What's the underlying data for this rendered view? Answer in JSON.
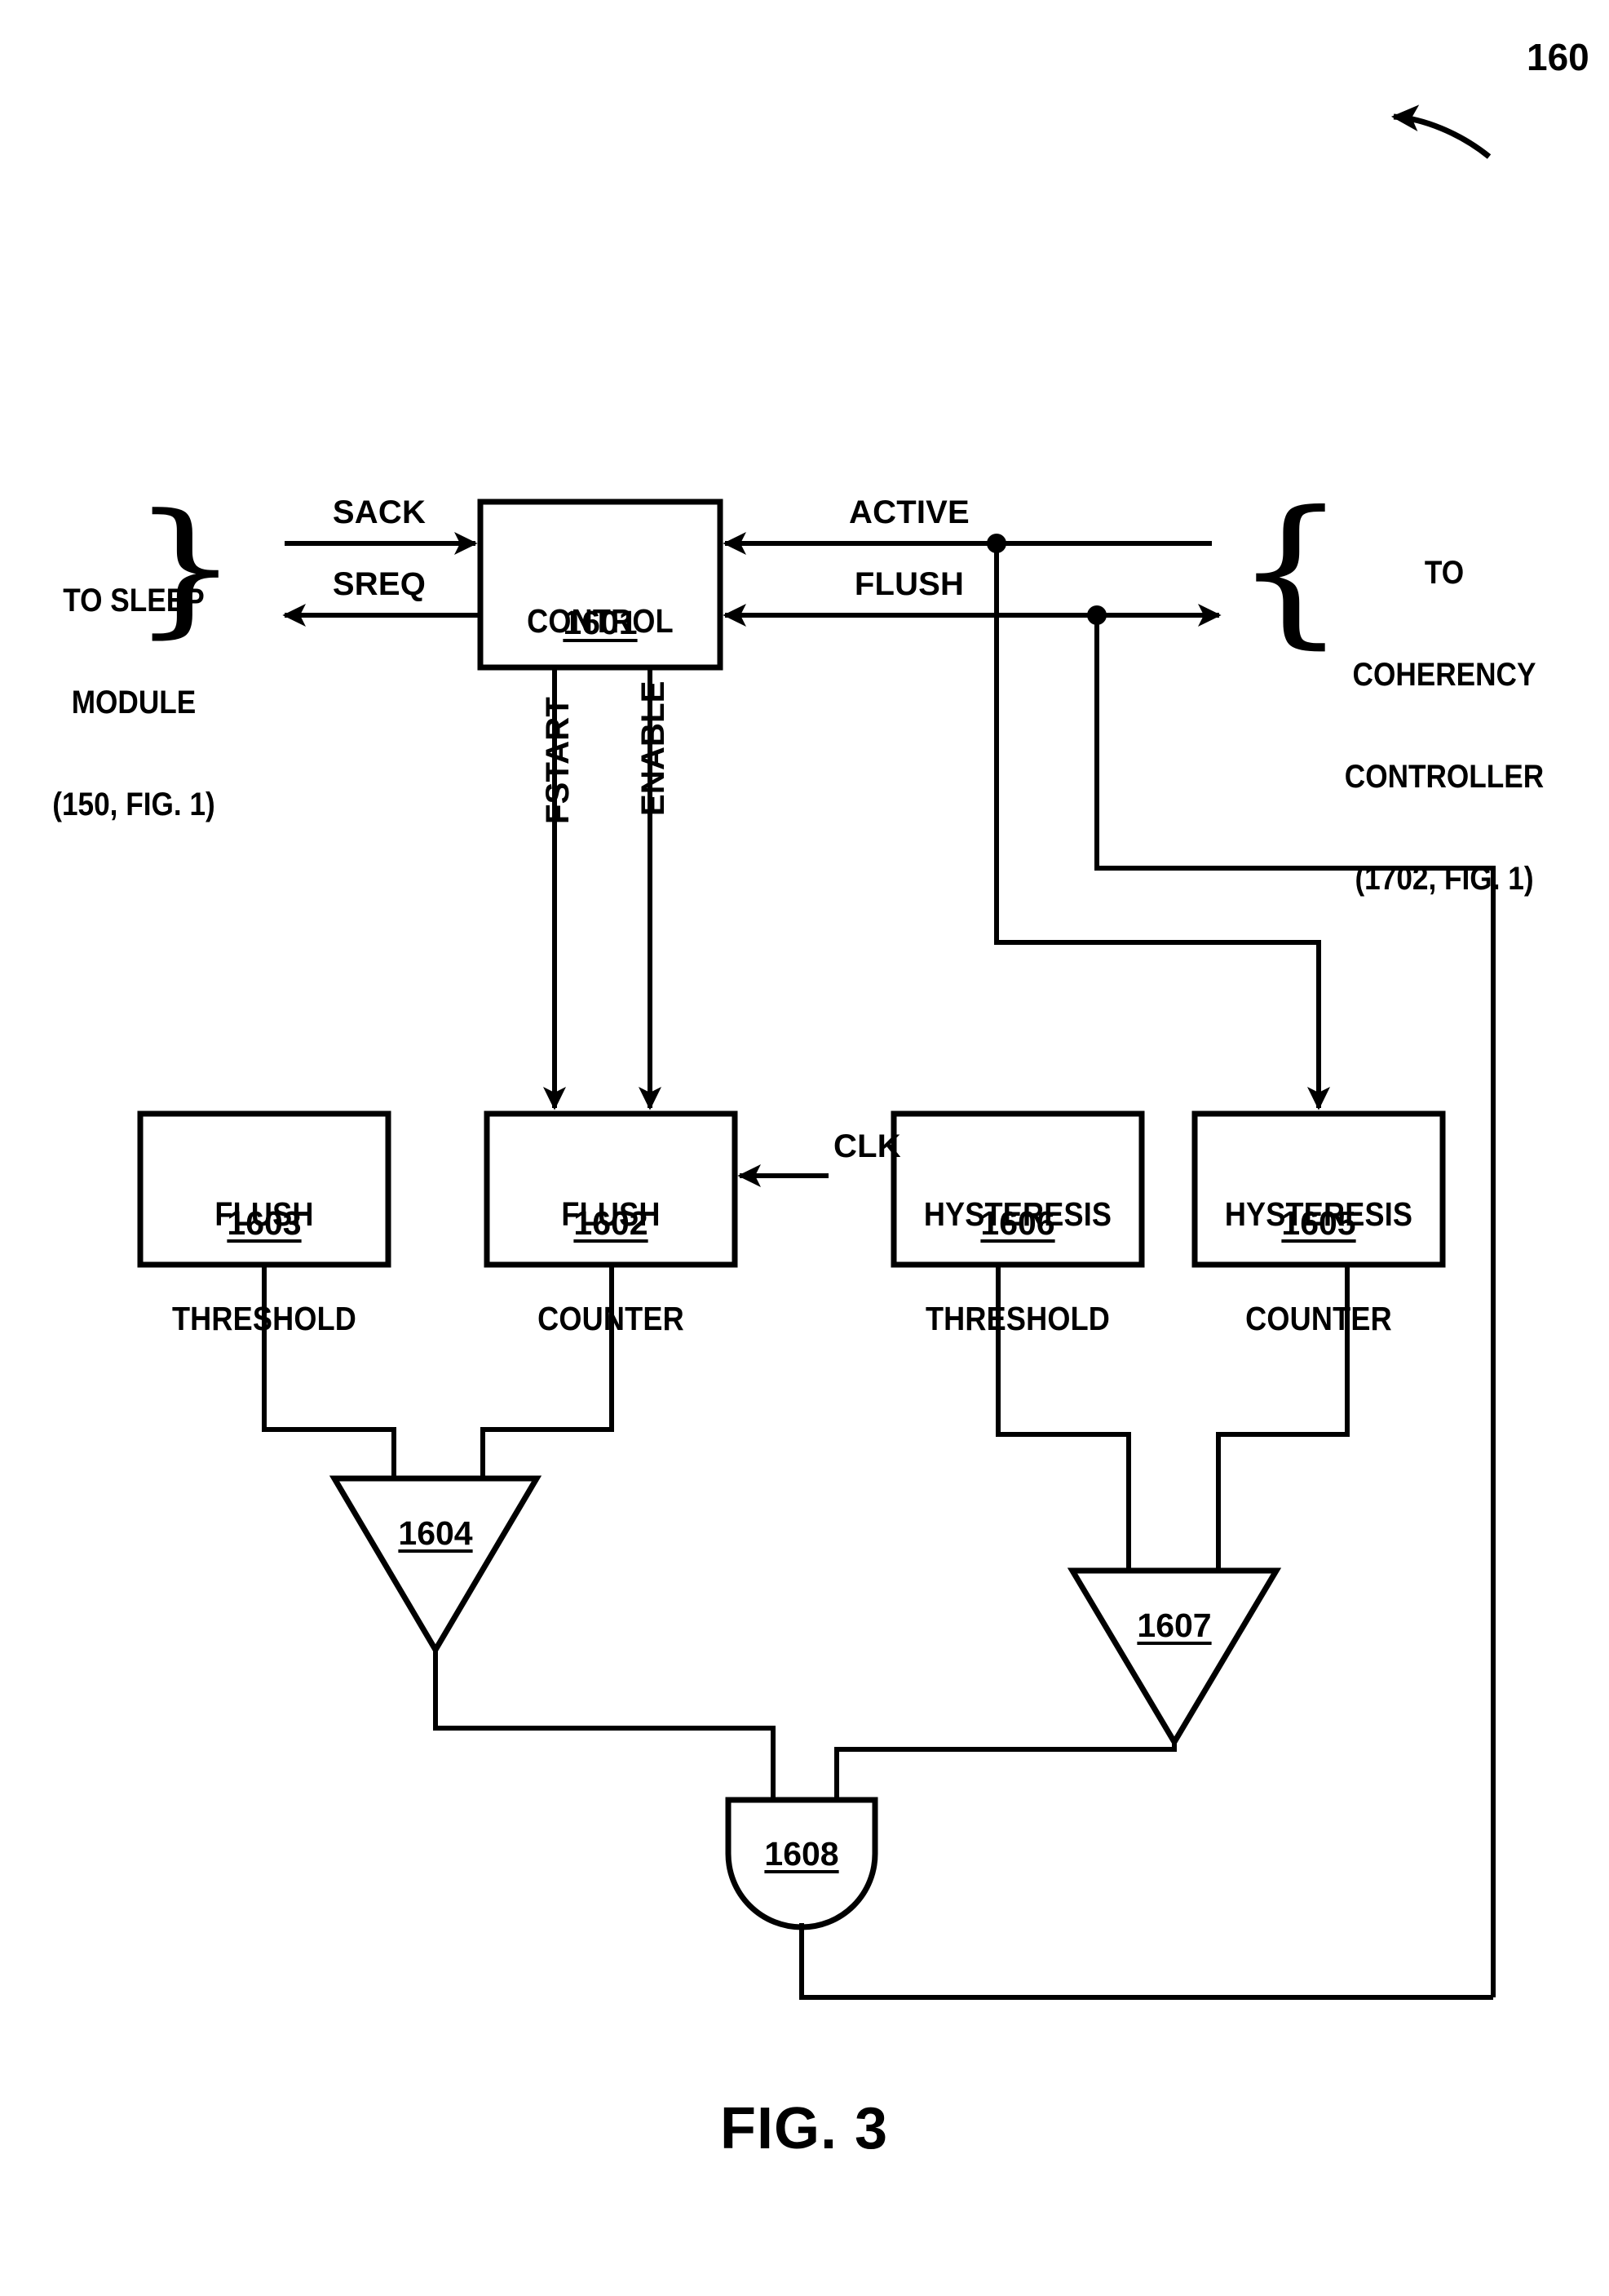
{
  "figure": {
    "caption": "FIG. 3",
    "reference_numeral": "160"
  },
  "blocks": [
    {
      "id": "control",
      "lines": [
        "CONTROL"
      ],
      "ref": "1601"
    },
    {
      "id": "flush-threshold",
      "lines": [
        "FLUSH",
        "THRESHOLD"
      ],
      "ref": "1603"
    },
    {
      "id": "flush-counter",
      "lines": [
        "FLUSH",
        "COUNTER"
      ],
      "ref": "1602"
    },
    {
      "id": "hysteresis-threshold",
      "lines": [
        "HYSTERESIS",
        "THRESHOLD"
      ],
      "ref": "1606"
    },
    {
      "id": "hysteresis-counter",
      "lines": [
        "HYSTERESIS",
        "COUNTER"
      ],
      "ref": "1605"
    }
  ],
  "comparators": [
    {
      "id": "flush-comparator",
      "ref": "1604"
    },
    {
      "id": "hysteresis-comparator",
      "ref": "1607"
    }
  ],
  "gates": [
    {
      "id": "and-gate",
      "ref": "1608",
      "type": "AND"
    }
  ],
  "signals": {
    "sack": "SACK",
    "sreq": "SREQ",
    "active": "ACTIVE",
    "flush": "FLUSH",
    "fstart": "FSTART",
    "enable": "ENABLE",
    "clk": "CLK"
  },
  "endpoints": {
    "left": {
      "id": "to-sleep-module",
      "lines": [
        "TO SLEEP",
        "MODULE",
        "(150, FIG. 1)"
      ]
    },
    "right": {
      "id": "to-coherency-controller",
      "lines": [
        "TO",
        "COHERENCY",
        "CONTROLLER",
        "(1702, FIG. 1)"
      ]
    }
  },
  "style": {
    "ink": "#000000",
    "paper": "#ffffff",
    "stroke_width": 6
  }
}
